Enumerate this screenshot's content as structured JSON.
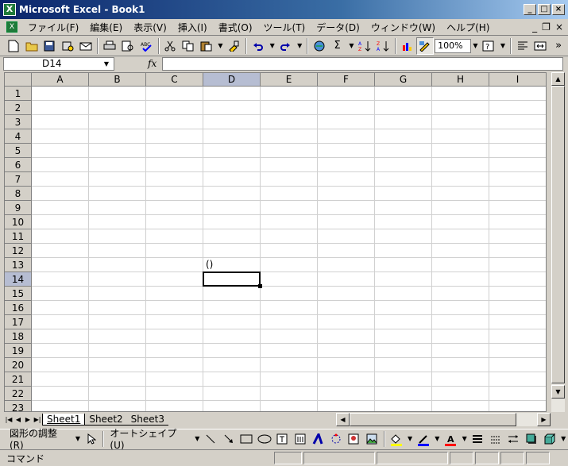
{
  "window": {
    "title": "Microsoft Excel - Book1",
    "minimize": "_",
    "restore": "□",
    "close": "×"
  },
  "menu": {
    "items": [
      "ファイル(F)",
      "編集(E)",
      "表示(V)",
      "挿入(I)",
      "書式(O)",
      "ツール(T)",
      "データ(D)",
      "ウィンドウ(W)",
      "ヘルプ(H)"
    ],
    "doc_minimize": "_",
    "doc_restore": "❐",
    "doc_close": "×"
  },
  "toolbar": {
    "zoom": "100%",
    "sum_glyph": "Σ",
    "icons": [
      "new-icon",
      "open-icon",
      "save-icon",
      "permission-icon",
      "email-icon",
      "print-icon",
      "print-preview-icon",
      "spelling-icon",
      "cut-icon",
      "copy-icon",
      "paste-icon",
      "format-painter-icon",
      "undo-icon",
      "redo-icon",
      "hyperlink-icon",
      "autosum-icon",
      "sort-ascending-icon",
      "sort-descending-icon",
      "chart-wizard-icon",
      "drawing-icon",
      "help-icon",
      "align-left-icon",
      "merge-center-icon"
    ]
  },
  "formula_bar": {
    "name_box": "D14",
    "fx": "fx",
    "value": ""
  },
  "grid": {
    "columns": [
      "A",
      "B",
      "C",
      "D",
      "E",
      "F",
      "G",
      "H",
      "I"
    ],
    "rows": [
      "1",
      "2",
      "3",
      "4",
      "5",
      "6",
      "7",
      "8",
      "9",
      "10",
      "11",
      "12",
      "13",
      "14",
      "15",
      "16",
      "17",
      "18",
      "19",
      "20",
      "21",
      "22",
      "23"
    ],
    "active_column": "D",
    "active_row": "14",
    "cells": [
      {
        "ref": "D13",
        "value": "()"
      }
    ]
  },
  "sheets": {
    "tabs": [
      "Sheet1",
      "Sheet2",
      "Sheet3"
    ],
    "active": "Sheet1"
  },
  "drawing_toolbar": {
    "draw_menu": "図形の調整(R)",
    "autoshapes_menu": "オートシェイプ(U)",
    "fill_color": "#ffff00",
    "line_color": "#0000ff",
    "font_color": "#ff0000"
  },
  "status": {
    "text": "コマンド"
  }
}
